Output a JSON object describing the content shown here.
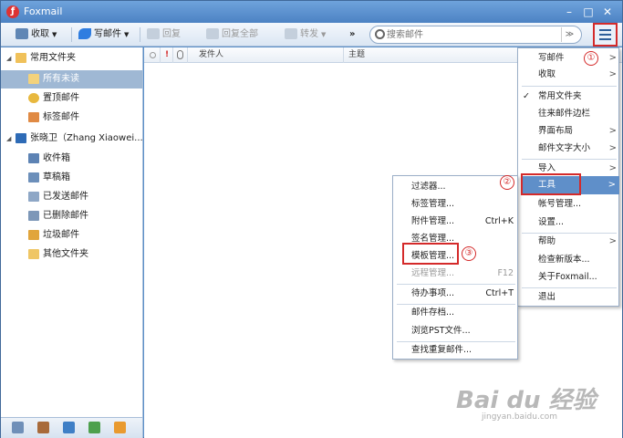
{
  "window": {
    "title": "Foxmail",
    "minimize": "–",
    "maximize": "□",
    "close": "✕"
  },
  "toolbar": {
    "receive": "收取",
    "compose": "写邮件",
    "reply": "回复",
    "reply_all": "回复全部",
    "forward": "转发",
    "more": "»",
    "search_placeholder": "搜索邮件",
    "search_drop": "≫"
  },
  "sidebar": {
    "common_folder": "常用文件夹",
    "common_items": [
      "所有未读",
      "置顶邮件",
      "标签邮件"
    ],
    "account": "张晓卫（Zhang Xiaowei...",
    "account_items": [
      "收件箱",
      "草稿箱",
      "已发送邮件",
      "已删除邮件",
      "垃圾邮件",
      "其他文件夹"
    ]
  },
  "list": {
    "flag": "!",
    "sender": "发件人",
    "subject": "主题"
  },
  "main_menu": {
    "items": [
      "写邮件",
      "收取",
      "常用文件夹",
      "往来邮件边栏",
      "界面布局",
      "邮件文字大小",
      "导入",
      "工具",
      "帐号管理...",
      "设置...",
      "帮助",
      "检查新版本...",
      "关于Foxmail...",
      "退出"
    ],
    "check": "✓"
  },
  "tools_menu": {
    "items": [
      "过滤器...",
      "标签管理...",
      "附件管理...",
      "签名管理...",
      "模板管理...",
      "远程管理...",
      "待办事项...",
      "邮件存档...",
      "浏览PST文件...",
      "查找重复邮件..."
    ],
    "shortcuts": {
      "attach": "Ctrl+K",
      "remote": "F12",
      "todo": "Ctrl+T"
    }
  },
  "markers": [
    "①",
    "②",
    "③"
  ],
  "watermark": {
    "logo": "Bai du 经验",
    "url": "jingyan.baidu.com"
  },
  "colors": {
    "accent": "#4c82c3",
    "highlight": "#d42a2a",
    "selected": "#9fb8d4"
  }
}
